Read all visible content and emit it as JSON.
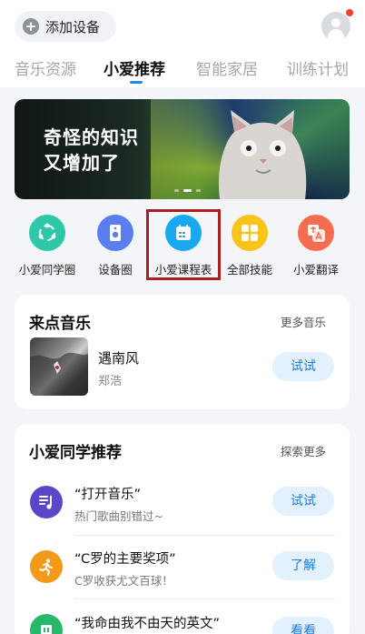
{
  "header": {
    "add_device_label": "添加设备",
    "tabs": [
      {
        "label": "音乐资源",
        "active": false
      },
      {
        "label": "小爱推荐",
        "active": true
      },
      {
        "label": "智能家居",
        "active": false
      },
      {
        "label": "训练计划",
        "active": false
      }
    ]
  },
  "banner": {
    "line1": "奇怪的知识",
    "line2": "又增加了"
  },
  "shortcuts": [
    {
      "label": "小爱同学圈",
      "icon": "share-circle-icon",
      "color": "#2ec7a7"
    },
    {
      "label": "设备圈",
      "icon": "speaker-icon",
      "color": "#5a7df0"
    },
    {
      "label": "小爱课程表",
      "icon": "calendar-icon",
      "color": "#19a9f2"
    },
    {
      "label": "全部技能",
      "icon": "grid-icon",
      "color": "#fac319"
    },
    {
      "label": "小爱翻译",
      "icon": "translate-icon",
      "color": "#f56d4f"
    }
  ],
  "music": {
    "title": "来点音乐",
    "more": "更多音乐",
    "song": {
      "title": "遇南风",
      "artist": "郑浩",
      "button": "试试"
    }
  },
  "recommend": {
    "title": "小爱同学推荐",
    "more": "探索更多",
    "items": [
      {
        "title": "“打开音乐”",
        "subtitle": "热门歌曲别错过~",
        "button": "试试",
        "icon": "music-note-icon",
        "color": "#5a46c9"
      },
      {
        "title": "“C罗的主要奖项”",
        "subtitle": "C罗收获尤文百球！",
        "button": "了解",
        "icon": "running-icon",
        "color": "#f39a1a"
      },
      {
        "title": "“我命由我不由天的英文”",
        "subtitle": "",
        "button": "看看",
        "icon": "robot-icon",
        "color": "#27b86a"
      }
    ]
  },
  "colors": {
    "accent": "#1a8cf0",
    "highlight_box": "#a71f1f",
    "button_bg": "#e2f1fd"
  }
}
